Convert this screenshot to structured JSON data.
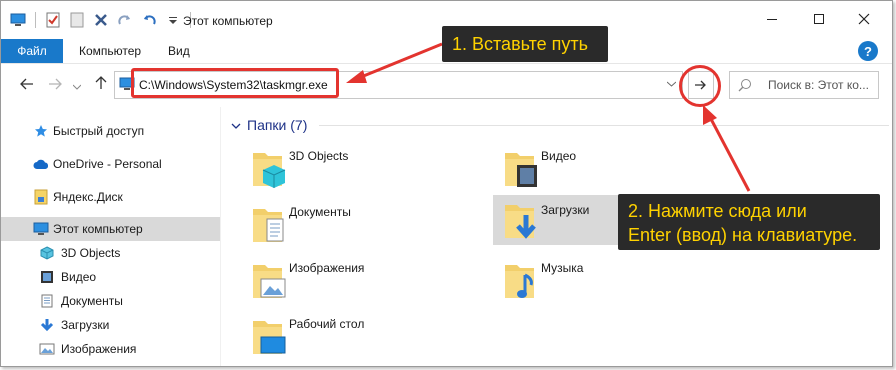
{
  "window": {
    "title": "Этот компьютер"
  },
  "ribbon": {
    "tabs": [
      {
        "label": "Файл",
        "active": true
      },
      {
        "label": "Компьютер"
      },
      {
        "label": "Вид"
      }
    ],
    "help_label": "?"
  },
  "address_bar": {
    "value": "C:\\Windows\\System32\\taskmgr.exe"
  },
  "search": {
    "placeholder": "Поиск в: Этот ко..."
  },
  "sidebar": {
    "items": [
      {
        "label": "Быстрый доступ",
        "icon": "star-icon"
      },
      {
        "label": "OneDrive - Personal",
        "icon": "cloud-icon"
      },
      {
        "label": "Яндекс.Диск",
        "icon": "yandex-disk-icon"
      },
      {
        "label": "Этот компьютер",
        "icon": "computer-icon",
        "selected": true
      },
      {
        "label": "3D Objects",
        "icon": "3d-objects-icon"
      },
      {
        "label": "Видео",
        "icon": "video-icon"
      },
      {
        "label": "Документы",
        "icon": "documents-icon"
      },
      {
        "label": "Загрузки",
        "icon": "downloads-icon"
      },
      {
        "label": "Изображения",
        "icon": "pictures-icon"
      }
    ]
  },
  "content": {
    "section_title": "Папки (7)",
    "folders": [
      {
        "label": "3D Objects",
        "icon": "3d-objects-icon"
      },
      {
        "label": "Видео",
        "icon": "video-icon"
      },
      {
        "label": "Документы",
        "icon": "documents-icon"
      },
      {
        "label": "Загрузки",
        "icon": "downloads-icon",
        "selected": true
      },
      {
        "label": "Изображения",
        "icon": "pictures-icon"
      },
      {
        "label": "Музыка",
        "icon": "music-icon"
      },
      {
        "label": "Рабочий стол",
        "icon": "desktop-icon"
      }
    ]
  },
  "annotations": {
    "step1": "1. Вставьте путь",
    "step2_line1": "2. Нажмите сюда или",
    "step2_line2": "Enter (ввод) на клавиатуре.",
    "accent_color": "#e3342f",
    "callout_text_color": "#ffd200"
  },
  "colors": {
    "file_tab": "#1979ca",
    "selection": "#d9d9d9",
    "section_title": "#1e3287"
  }
}
